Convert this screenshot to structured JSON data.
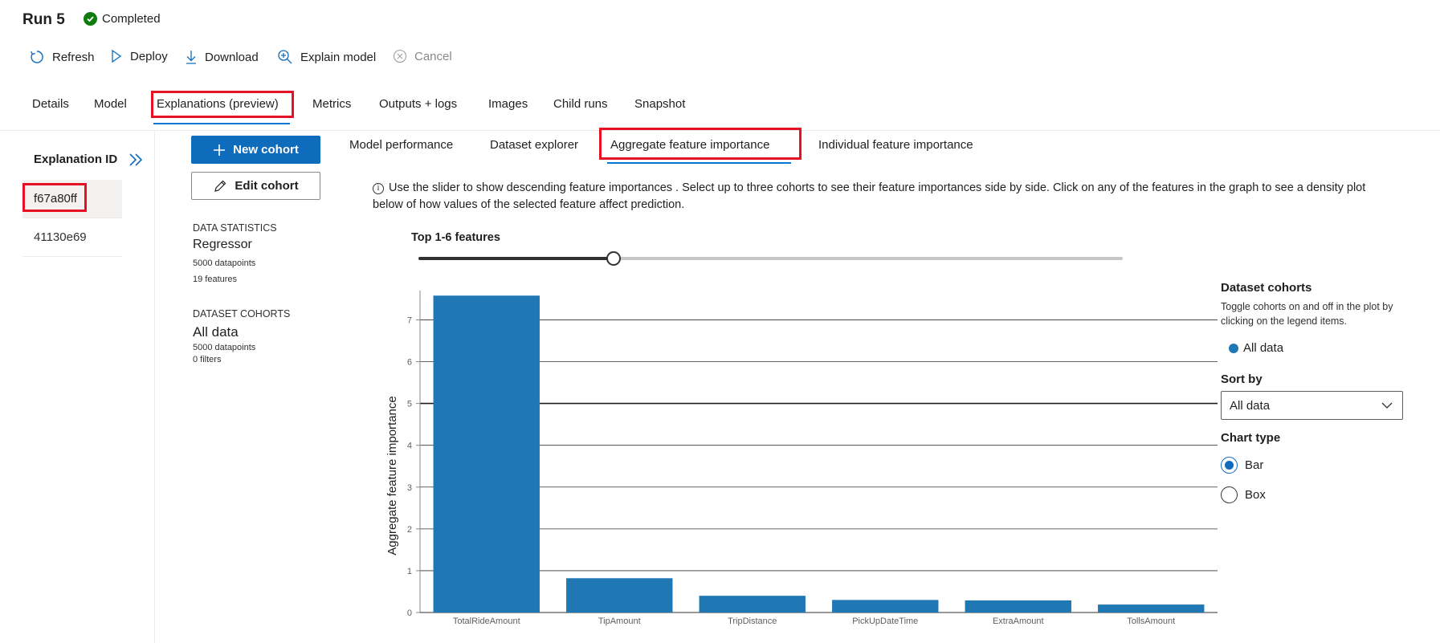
{
  "header": {
    "run_title": "Run 5",
    "status": "Completed"
  },
  "toolbar": {
    "refresh": "Refresh",
    "deploy": "Deploy",
    "download": "Download",
    "explain_model": "Explain model",
    "cancel": "Cancel"
  },
  "tabs": [
    {
      "label": "Details"
    },
    {
      "label": "Model"
    },
    {
      "label": "Explanations (preview)",
      "active": true
    },
    {
      "label": "Metrics"
    },
    {
      "label": "Outputs + logs"
    },
    {
      "label": "Images"
    },
    {
      "label": "Child runs"
    },
    {
      "label": "Snapshot"
    }
  ],
  "explanations": {
    "header": "Explanation ID",
    "items": [
      {
        "id": "f67a80ff",
        "selected": true
      },
      {
        "id": "41130e69",
        "selected": false
      }
    ]
  },
  "cohort": {
    "new_cohort": "New cohort",
    "edit_cohort": "Edit cohort",
    "data_statistics_heading": "DATA STATISTICS",
    "model_type": "Regressor",
    "datapoints": "5000 datapoints",
    "features": "19 features",
    "dataset_cohorts_heading": "DATASET COHORTS",
    "cohort_name": "All data",
    "cohort_datapoints": "5000 datapoints",
    "cohort_filters": "0 filters"
  },
  "sub_tabs": [
    {
      "label": "Model performance"
    },
    {
      "label": "Dataset explorer"
    },
    {
      "label": "Aggregate feature importance",
      "active": true
    },
    {
      "label": "Individual feature importance"
    }
  ],
  "info_text": "Use the slider to show descending feature importances . Select up to three cohorts to see their feature importances side by side. Click on any of the features in the graph to see a density plot below of how values of the selected feature affect prediction.",
  "slider": {
    "label": "Top 1-6 features",
    "value": 6,
    "max": 19,
    "fraction": 0.277
  },
  "chart_data": {
    "type": "bar",
    "ylabel": "Aggregate feature importance",
    "categories": [
      "TotalRideAmount",
      "TipAmount",
      "TripDistance",
      "PickUpDateTime",
      "ExtraAmount",
      "TollsAmount"
    ],
    "series": [
      {
        "name": "All data",
        "color": "#1f77b4",
        "values": [
          7.58,
          0.82,
          0.4,
          0.3,
          0.29,
          0.19
        ]
      }
    ],
    "yticks": [
      0,
      1,
      2,
      3,
      4,
      5,
      6,
      7
    ],
    "ylim": [
      0,
      7.7
    ]
  },
  "right_panel": {
    "dataset_cohorts_title": "Dataset cohorts",
    "dataset_cohorts_desc": "Toggle cohorts on and off in the plot by clicking on the legend items.",
    "legend_label": "All data",
    "sort_by_title": "Sort by",
    "sort_by_value": "All data",
    "chart_type_title": "Chart type",
    "chart_type_options": [
      {
        "label": "Bar",
        "checked": true
      },
      {
        "label": "Box",
        "checked": false
      }
    ]
  },
  "colors": {
    "accent": "#0f6cbd",
    "highlight": "#e81123",
    "bar": "#1f77b4",
    "success": "#107c10"
  }
}
